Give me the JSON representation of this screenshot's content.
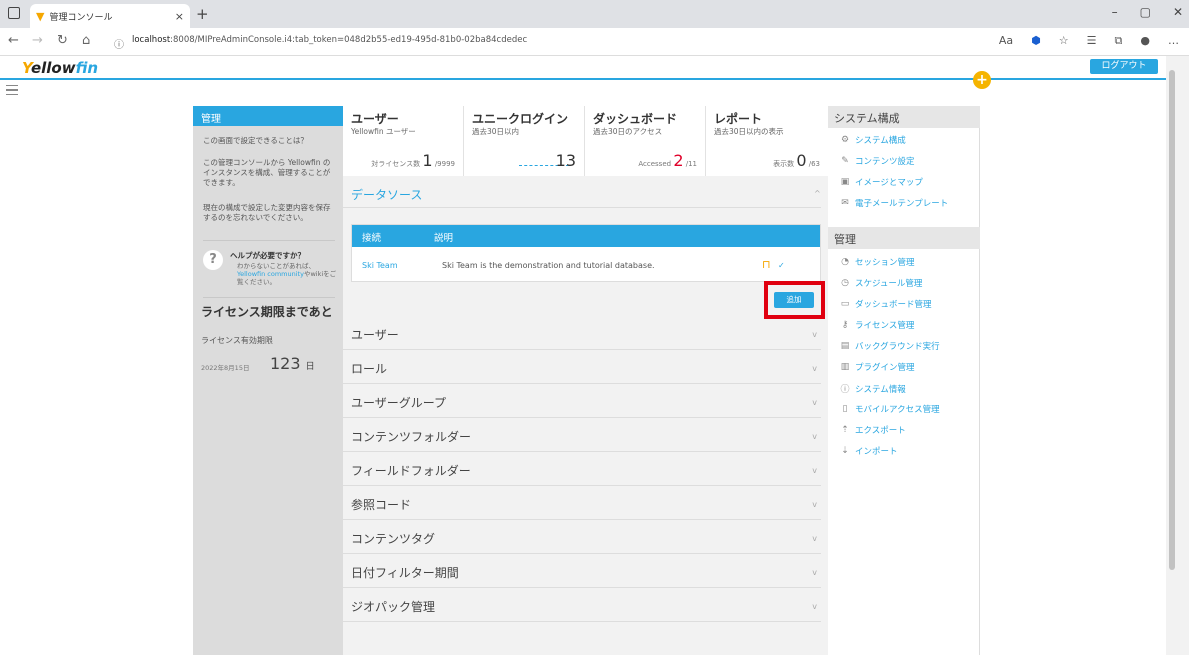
{
  "browser": {
    "tab_title": "管理コンソール",
    "tab_close": "×",
    "new_tab": "+",
    "url_host": "localhost",
    "url_rest": ":8008/MIPreAdminConsole.i4:tab_token=048d2b55-ed19-495d-81b0-02ba84cdedec",
    "window_controls": [
      "–",
      "▢",
      "✕"
    ]
  },
  "header": {
    "logo_y": "Y",
    "logo_ellow": "ellow",
    "logo_fin": "fin",
    "logout_label": "ログアウト",
    "plus_label": "+"
  },
  "left_panel": {
    "title": "管理",
    "question": "この画面で設定できることは？",
    "desc": "この管理コンソールから Yellowfin のインスタンスを構成、管理することができます。",
    "warning": "現在の構成で設定した変更内容を保存するのを忘れないでください。",
    "help_icon": "?",
    "help_title": "ヘルプが必要ですか？",
    "help_desc_1": "わからないことがあれば、",
    "help_desc_link": "Yellowfin community",
    "help_desc_2": "やwikiをご覧ください。",
    "license_title": "ライセンス期限まであと",
    "license_sub": "ライセンス有効期限",
    "license_date": "2022年8月15日",
    "license_days": "123",
    "license_unit": "日"
  },
  "stats": [
    {
      "title": "ユーザー",
      "sub": "Yellowfin ユーザー",
      "prefix": "対ライセンス数",
      "value": "1",
      "suffix": "/9999"
    },
    {
      "title": "ユニークログイン",
      "sub": "過去30日以内",
      "prefix": "",
      "value": "13",
      "suffix": ""
    },
    {
      "title": "ダッシュボード",
      "sub": "過去30日のアクセス",
      "prefix": "Accessed",
      "value": "2",
      "suffix": "/11"
    },
    {
      "title": "レポート",
      "sub": "過去30日以内の表示",
      "prefix": "表示数",
      "value": "0",
      "suffix": "/63"
    }
  ],
  "datasource": {
    "title": "データソース",
    "col_connection": "接続",
    "col_description": "説明",
    "row_name": "Ski Team",
    "row_desc": "Ski Team is the demonstration and tutorial database.",
    "add_label": "追加"
  },
  "sections": [
    "ユーザー",
    "ロール",
    "ユーザーグループ",
    "コンテンツフォルダー",
    "フィールドフォルダー",
    "参照コード",
    "コンテンツタグ",
    "日付フィルター期間",
    "ジオパック管理"
  ],
  "right_panel": {
    "system_title": "システム構成",
    "system_items": [
      {
        "icon": "⚙",
        "label": "システム構成"
      },
      {
        "icon": "✎",
        "label": "コンテンツ設定"
      },
      {
        "icon": "▣",
        "label": "イメージとマップ"
      },
      {
        "icon": "✉",
        "label": "電子メールテンプレート"
      }
    ],
    "admin_title": "管理",
    "admin_items": [
      {
        "icon": "◔",
        "label": "セッション管理"
      },
      {
        "icon": "◷",
        "label": "スケジュール管理"
      },
      {
        "icon": "▭",
        "label": "ダッシュボード管理"
      },
      {
        "icon": "⚷",
        "label": "ライセンス管理"
      },
      {
        "icon": "▤",
        "label": "バックグラウンド実行"
      },
      {
        "icon": "▥",
        "label": "プラグイン管理"
      },
      {
        "icon": "ⓘ",
        "label": "システム情報"
      },
      {
        "icon": "▯",
        "label": "モバイルアクセス管理"
      },
      {
        "icon": "⇡",
        "label": "エクスポート"
      },
      {
        "icon": "⇣",
        "label": "インポート"
      }
    ]
  }
}
